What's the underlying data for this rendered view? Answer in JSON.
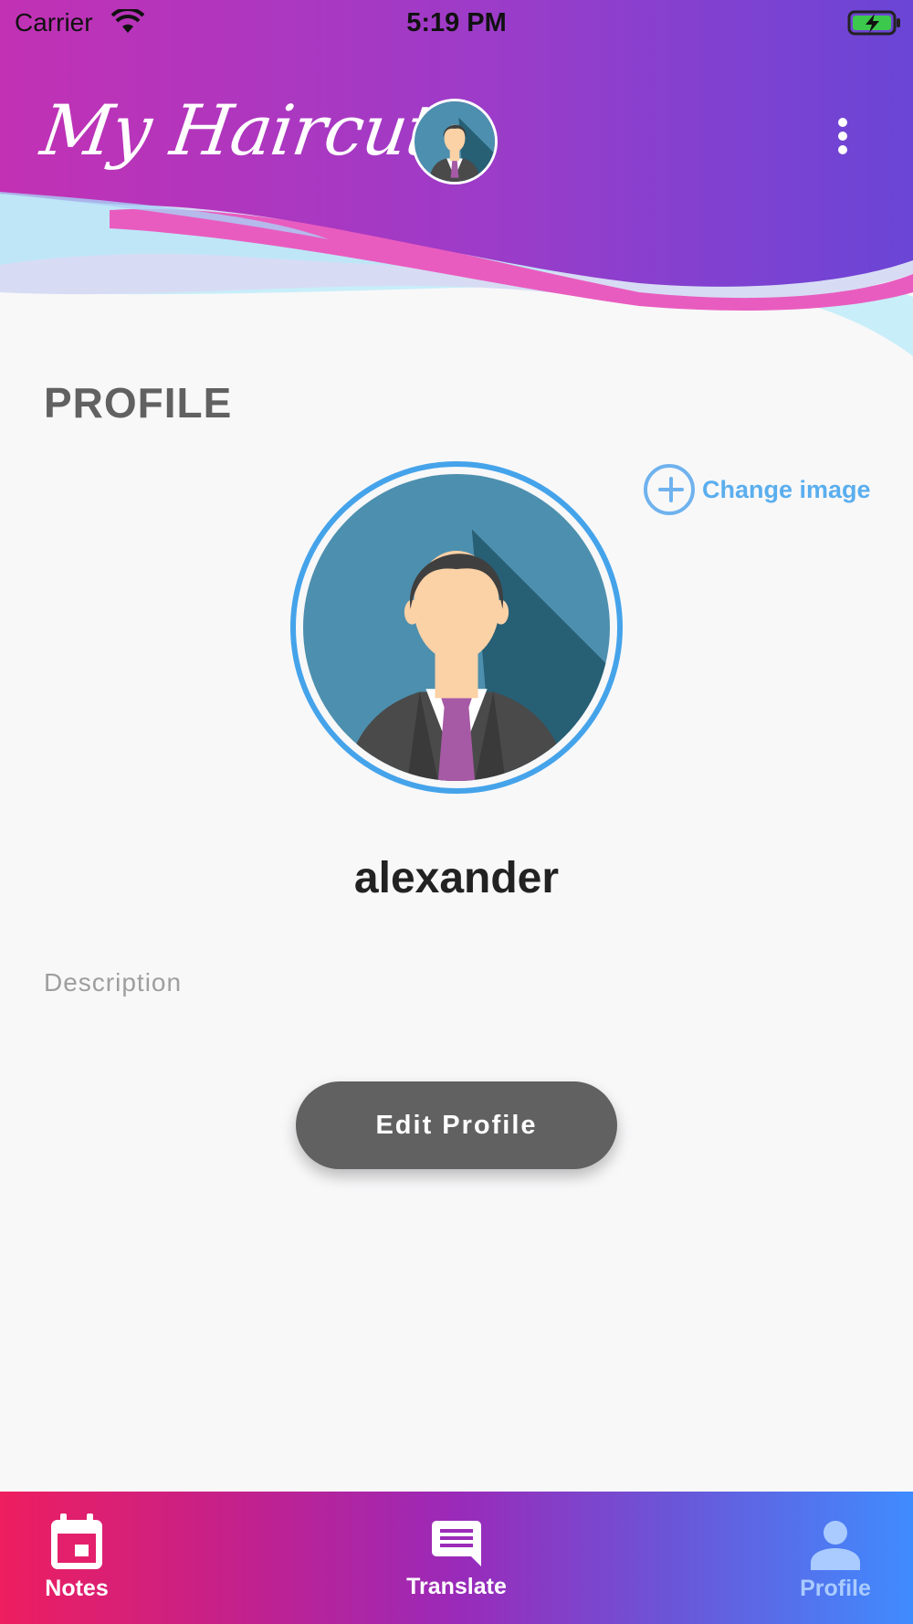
{
  "status_bar": {
    "carrier": "Carrier",
    "time": "5:19 PM"
  },
  "header": {
    "logo_text": "My Haircut"
  },
  "profile": {
    "title": "PROFILE",
    "change_image_label": "Change image",
    "username": "alexander",
    "description_placeholder": "Description",
    "edit_button_label": "Edit Profile"
  },
  "tab_bar": {
    "tabs": [
      {
        "label": "Notes",
        "icon": "calendar-icon",
        "active": true
      },
      {
        "label": "Translate",
        "icon": "message-icon",
        "active": false
      },
      {
        "label": "Profile",
        "icon": "person-icon",
        "active": false
      }
    ]
  },
  "colors": {
    "header_gradient_start": "#c231b4",
    "header_gradient_end": "#6a45d6",
    "avatar_ring": "#45a3ea",
    "accent_link": "#5aaeee",
    "button_bg": "#616161",
    "tab_gradient_start": "#ee1e5f",
    "tab_gradient_end": "#3f8cff"
  }
}
